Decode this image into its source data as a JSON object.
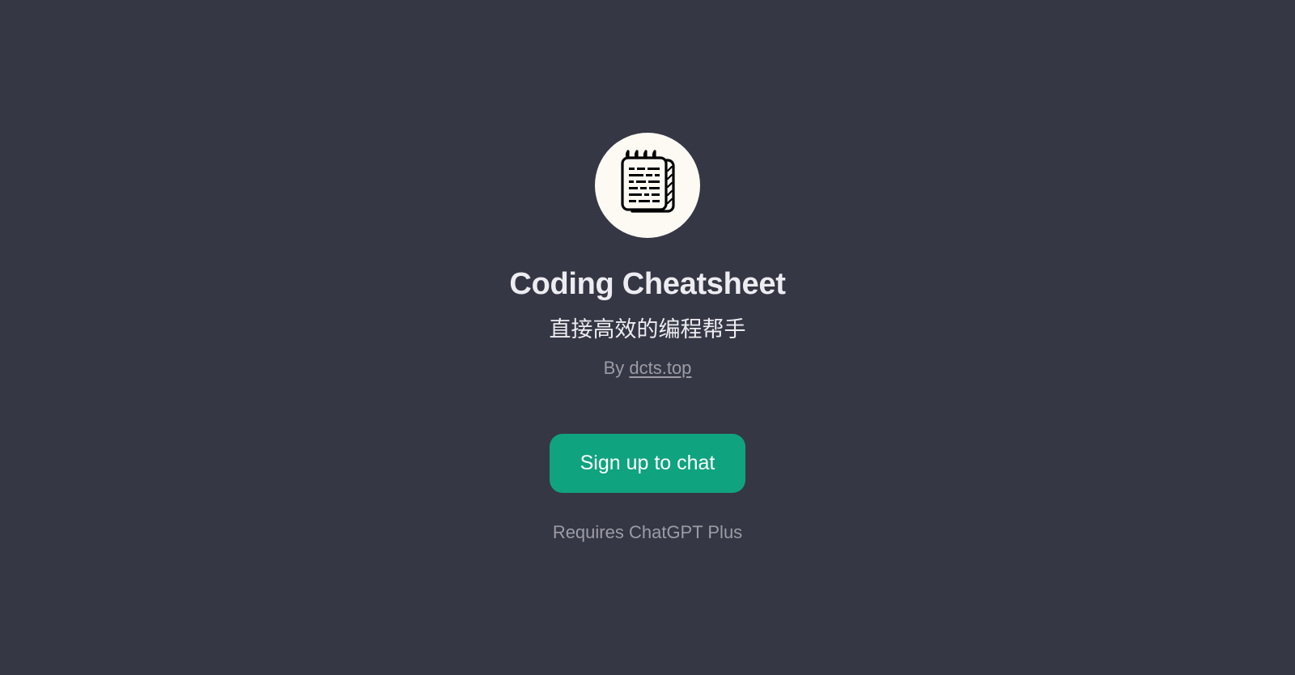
{
  "gpt": {
    "title": "Coding Cheatsheet",
    "subtitle": "直接高效的编程帮手",
    "author_prefix": "By ",
    "author_link": "dcts.top"
  },
  "actions": {
    "signup_label": "Sign up to chat",
    "requires_label": "Requires ChatGPT Plus"
  }
}
